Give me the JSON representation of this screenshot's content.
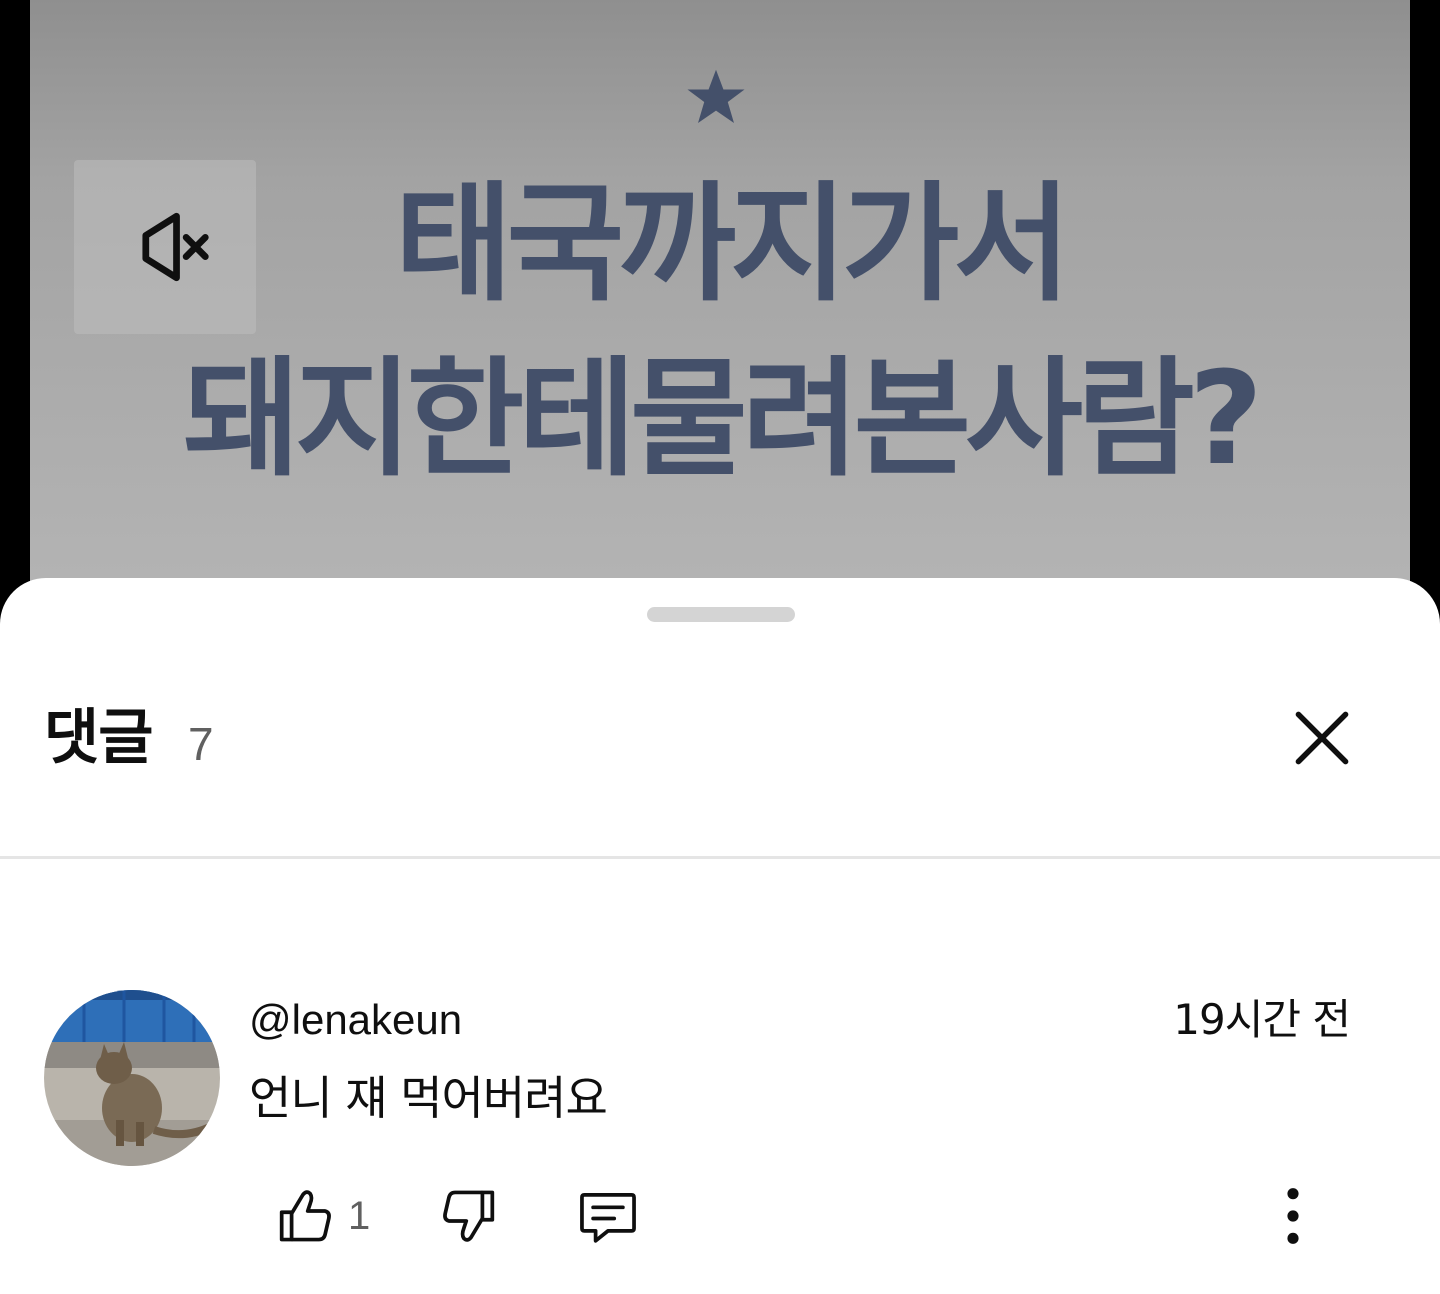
{
  "video": {
    "overlay_title_line1": "태국까지가서",
    "overlay_title_line2": "돼지한테물려본사람?",
    "mute_icon": "volume-muted-icon",
    "colors": {
      "text": "#44506a",
      "background": "#a3a3a3"
    }
  },
  "comments_sheet": {
    "title": "댓글",
    "count": "7",
    "close_icon": "close-icon"
  },
  "comments": [
    {
      "author": "@lenakeun",
      "time": "19시간 전",
      "text": "언니 쟤 먹어버려요",
      "like_count": "1",
      "icons": [
        "thumbs-up-icon",
        "thumbs-down-icon",
        "reply-icon",
        "more-vert-icon"
      ]
    }
  ]
}
